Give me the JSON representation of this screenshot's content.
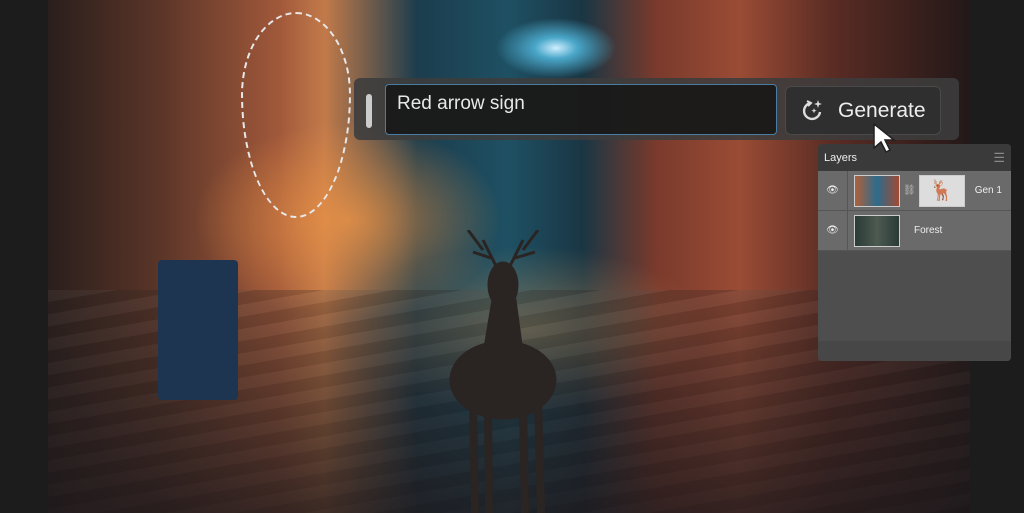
{
  "prompt": {
    "value": "Red arrow sign"
  },
  "generate": {
    "label": "Generate",
    "icon": "generative-sparkle-icon"
  },
  "layers": {
    "title": "Layers",
    "items": [
      {
        "name": "Gen 1",
        "has_mask": true,
        "visible": true
      },
      {
        "name": "Forest",
        "has_mask": false,
        "visible": true
      }
    ]
  },
  "colors": {
    "accent": "#4a7da3",
    "panel": "#4e4e4e"
  }
}
